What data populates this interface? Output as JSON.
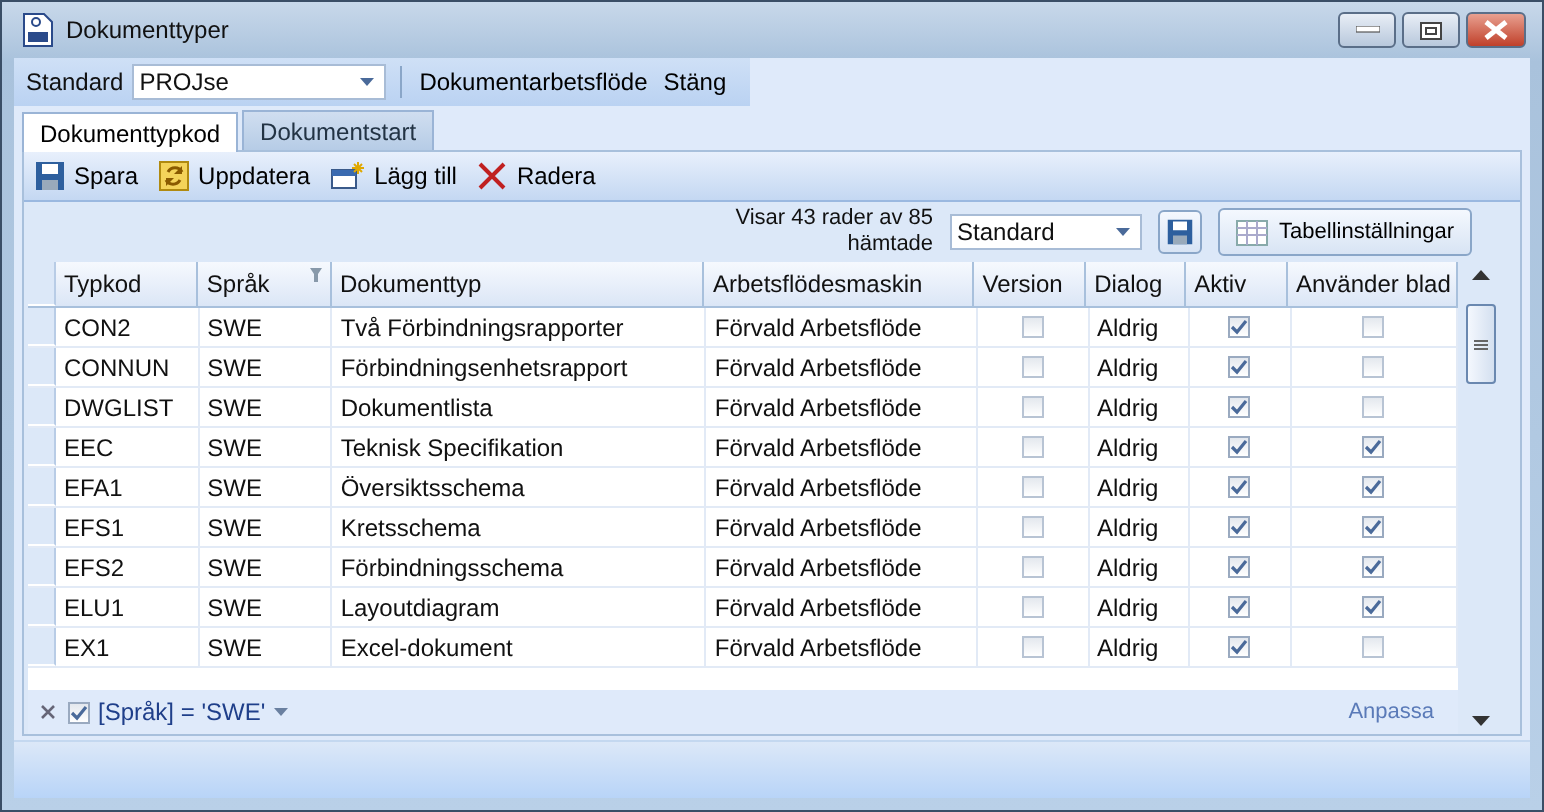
{
  "window": {
    "title": "Dokumenttyper"
  },
  "top_bar": {
    "label": "Standard",
    "value": "PROJse",
    "links": [
      "Dokumentarbetsflöde",
      "Stäng"
    ]
  },
  "tabs": [
    {
      "label": "Dokumenttypkod",
      "selected": true
    },
    {
      "label": "Dokumentstart",
      "selected": false
    }
  ],
  "actions": [
    {
      "kind": "save",
      "label": "Spara"
    },
    {
      "kind": "refresh",
      "label": "Uppdatera"
    },
    {
      "kind": "add",
      "label": "Lägg till"
    },
    {
      "kind": "delete",
      "label": "Radera"
    }
  ],
  "grid_info": "Visar 43 rader av 85 hämtade",
  "layout_select": {
    "value": "Standard"
  },
  "settings_button": "Tabellinställningar",
  "columns": [
    "Typkod",
    "Språk",
    "Dokumenttyp",
    "Arbetsflödesmaskin",
    "Version",
    "Dialog",
    "Aktiv",
    "Använder blad"
  ],
  "rows": [
    {
      "typkod": "CON2",
      "sprak": "SWE",
      "typ": "Två Förbindningsrapporter",
      "maskin": "Förvald Arbetsflöde",
      "version": false,
      "dialog": "Aldrig",
      "aktiv": true,
      "blad": false
    },
    {
      "typkod": "CONNUN",
      "sprak": "SWE",
      "typ": "Förbindningsenhetsrapport",
      "maskin": "Förvald Arbetsflöde",
      "version": false,
      "dialog": "Aldrig",
      "aktiv": true,
      "blad": false
    },
    {
      "typkod": "DWGLIST",
      "sprak": "SWE",
      "typ": "Dokumentlista",
      "maskin": "Förvald Arbetsflöde",
      "version": false,
      "dialog": "Aldrig",
      "aktiv": true,
      "blad": false
    },
    {
      "typkod": "EEC",
      "sprak": "SWE",
      "typ": "Teknisk Specifikation",
      "maskin": "Förvald Arbetsflöde",
      "version": false,
      "dialog": "Aldrig",
      "aktiv": true,
      "blad": true
    },
    {
      "typkod": "EFA1",
      "sprak": "SWE",
      "typ": "Översiktsschema",
      "maskin": "Förvald Arbetsflöde",
      "version": false,
      "dialog": "Aldrig",
      "aktiv": true,
      "blad": true
    },
    {
      "typkod": "EFS1",
      "sprak": "SWE",
      "typ": "Kretsschema",
      "maskin": "Förvald Arbetsflöde",
      "version": false,
      "dialog": "Aldrig",
      "aktiv": true,
      "blad": true
    },
    {
      "typkod": "EFS2",
      "sprak": "SWE",
      "typ": "Förbindningsschema",
      "maskin": "Förvald Arbetsflöde",
      "version": false,
      "dialog": "Aldrig",
      "aktiv": true,
      "blad": true
    },
    {
      "typkod": "ELU1",
      "sprak": "SWE",
      "typ": "Layoutdiagram",
      "maskin": "Förvald Arbetsflöde",
      "version": false,
      "dialog": "Aldrig",
      "aktiv": true,
      "blad": true
    },
    {
      "typkod": "EX1",
      "sprak": "SWE",
      "typ": "Excel-dokument",
      "maskin": "Förvald Arbetsflöde",
      "version": false,
      "dialog": "Aldrig",
      "aktiv": true,
      "blad": false
    }
  ],
  "filter": {
    "enabled": true,
    "text": "[Språk] = 'SWE'"
  },
  "customize_link": "Anpassa"
}
